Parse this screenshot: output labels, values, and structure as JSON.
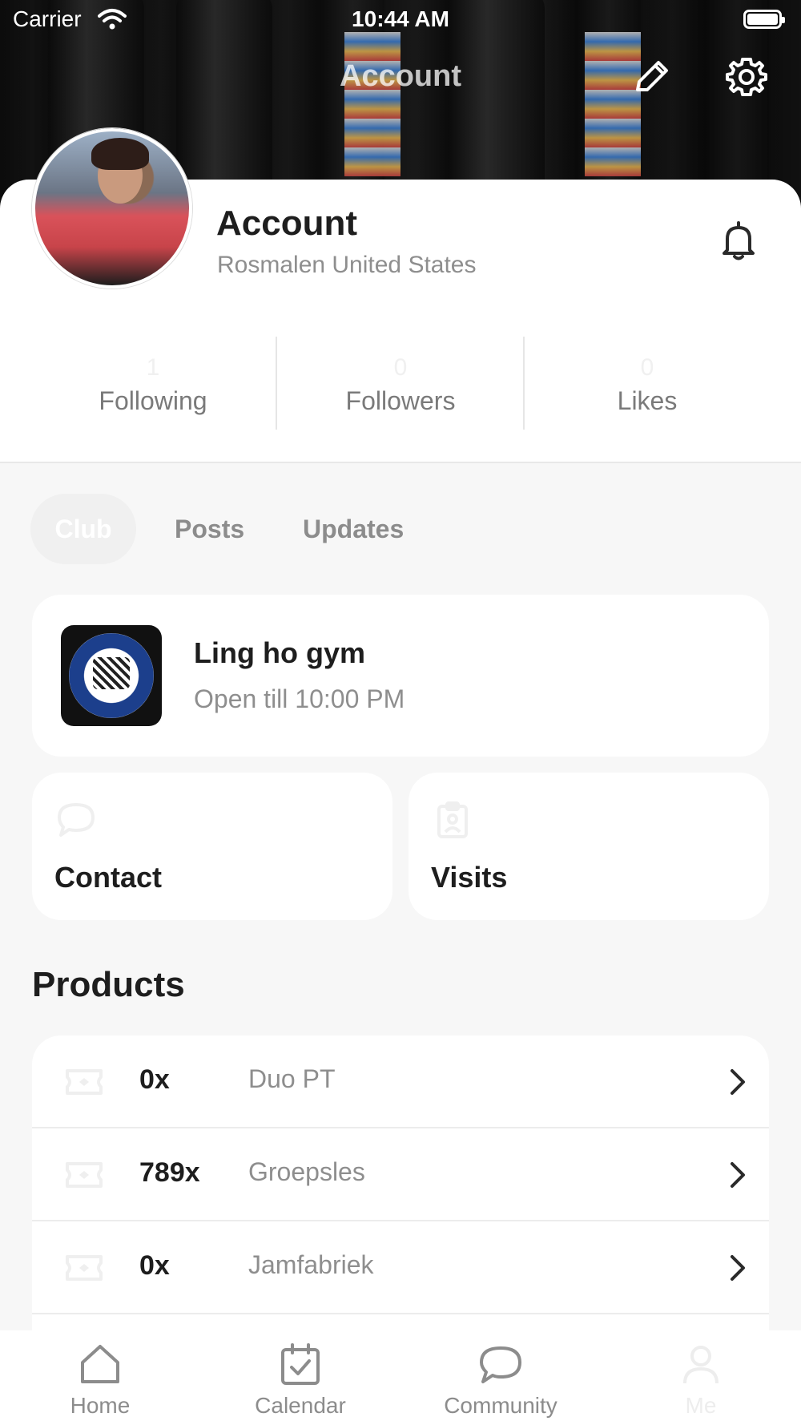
{
  "status_bar": {
    "carrier": "Carrier",
    "time": "10:44 AM"
  },
  "nav": {
    "title": "Account",
    "edit_icon": "pencil-icon",
    "settings_icon": "gear-icon"
  },
  "profile": {
    "name": "Account",
    "location": "Rosmalen United States",
    "notification_icon": "bell-icon"
  },
  "stats": [
    {
      "value": "1",
      "label": "Following"
    },
    {
      "value": "0",
      "label": "Followers"
    },
    {
      "value": "0",
      "label": "Likes"
    }
  ],
  "tabs": {
    "items": [
      {
        "label": "Club",
        "active": true
      },
      {
        "label": "Posts",
        "active": false
      },
      {
        "label": "Updates",
        "active": false
      }
    ]
  },
  "club": {
    "name": "Ling ho gym",
    "hours": "Open till 10:00 PM"
  },
  "actions": [
    {
      "label": "Contact",
      "icon": "chat-bubble-icon"
    },
    {
      "label": "Visits",
      "icon": "badge-icon"
    }
  ],
  "products": {
    "title": "Products",
    "items": [
      {
        "count": "0x",
        "name": "Duo PT"
      },
      {
        "count": "789x",
        "name": "Groepsles"
      },
      {
        "count": "0x",
        "name": "Jamfabriek"
      }
    ]
  },
  "tabbar": {
    "items": [
      {
        "label": "Home",
        "icon": "home-icon"
      },
      {
        "label": "Calendar",
        "icon": "calendar-icon"
      },
      {
        "label": "Community",
        "icon": "chat-bubble-icon"
      },
      {
        "label": "Me",
        "icon": "person-icon"
      }
    ]
  },
  "colors": {
    "background": "#f7f7f7",
    "card": "#ffffff",
    "text_primary": "#1e1e1e",
    "text_secondary": "#8e8e8e"
  }
}
